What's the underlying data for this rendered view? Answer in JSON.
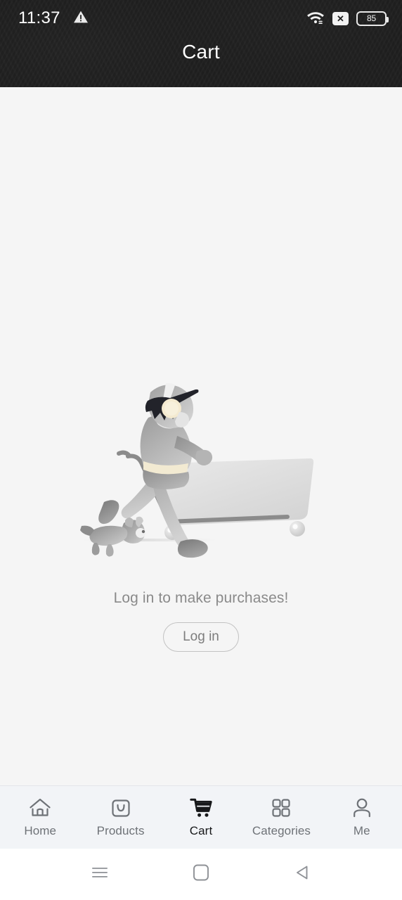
{
  "status_bar": {
    "time": "11:37",
    "warning_icon": "warning-triangle-icon",
    "wifi_icon": "wifi-icon",
    "sim_off_icon": "mobile-data-off-icon",
    "sim_off_glyph": "✕",
    "battery_level": "85",
    "battery_icon": "battery-icon",
    "background_color": "#1f1f1f"
  },
  "header": {
    "title": "Cart"
  },
  "main": {
    "illustration_name": "empty-cart-shopper-illustration",
    "illustration_alt": "Person pushing a shopping cart with a dog running alongside",
    "empty_message": "Log in to make purchases!",
    "login_button_label": "Log in",
    "background_color": "#f5f5f5",
    "message_color": "#8a8a8a",
    "button_border_color": "#c2c2c2"
  },
  "tab_bar": {
    "background_color": "#f2f4f7",
    "active_color": "#17181a",
    "inactive_color": "#6e7277",
    "active_index": 2,
    "tabs": [
      {
        "label": "Home",
        "icon": "home-icon",
        "active": false
      },
      {
        "label": "Products",
        "icon": "shopping-bag-icon",
        "active": false
      },
      {
        "label": "Cart",
        "icon": "shopping-cart-icon",
        "active": true
      },
      {
        "label": "Categories",
        "icon": "grid-icon",
        "active": false
      },
      {
        "label": "Me",
        "icon": "person-icon",
        "active": false
      }
    ]
  },
  "android_nav": {
    "background_color": "#ffffff",
    "buttons": [
      {
        "name": "recents-button",
        "icon": "menu-lines-icon"
      },
      {
        "name": "home-button",
        "icon": "rounded-square-icon"
      },
      {
        "name": "back-button",
        "icon": "triangle-left-icon"
      }
    ]
  }
}
